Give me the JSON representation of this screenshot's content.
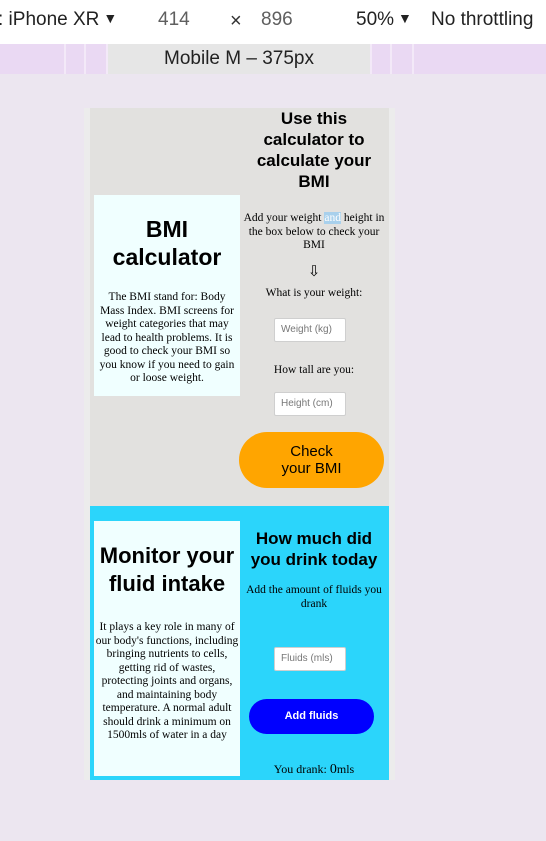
{
  "devtools": {
    "device": ": iPhone XR",
    "width": "414",
    "times": "×",
    "height": "896",
    "zoom": "50%",
    "throttling": "No throttling",
    "media_query_label": "Mobile M – 375px"
  },
  "bmi": {
    "card_title": "BMI calculator",
    "card_text": "The BMI stand for: Body Mass Index. BMI screens for weight categories that may lead to health problems. It is good to check your BMI so you know if you need to gain or loose weight.",
    "heading": "Use this calculator to calculate your BMI",
    "intro_before": "Add your weight ",
    "intro_highlight": "and",
    "intro_after": " height in the box below to check your BMI",
    "arrow": "⇩",
    "weight_label": "What is your weight:",
    "weight_placeholder": "Weight (kg)",
    "height_label": "How tall are you:",
    "height_placeholder": "Height (cm)",
    "button": "Check your BMI"
  },
  "fluid": {
    "card_title": "Monitor your fluid intake",
    "card_text": "It plays a key role in many of our body's functions, including bringing nutrients to cells, getting rid of wastes, protecting joints and organs, and maintaining body temperature. A normal adult should drink a minimum on 1500mls of water in a day",
    "heading": "How much did you drink today",
    "intro": "Add the amount of fluids you drank",
    "placeholder": "Fluids (mls)",
    "button": "Add fluids",
    "drank_label": "You drank: ",
    "drank_value": "0",
    "drank_unit": "mls"
  },
  "colors": {
    "bmi_bg": "#e2e1df",
    "fluid_bg": "#2bd5fb",
    "card_bg": "#f0ffff",
    "orange_button": "#ffa500",
    "blue_button": "#0000ff"
  }
}
